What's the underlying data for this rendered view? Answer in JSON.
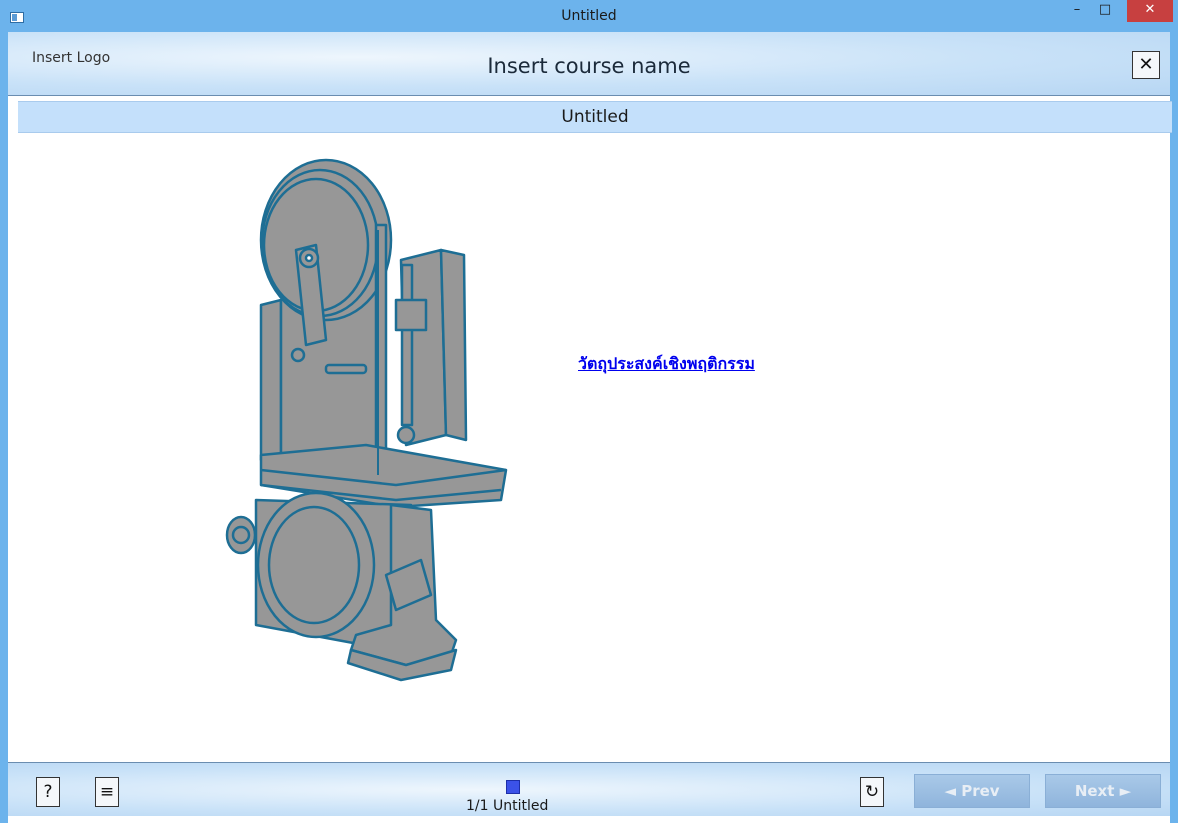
{
  "window": {
    "title": "Untitled",
    "minimize": "–",
    "maximize": "□",
    "close": "✕"
  },
  "header": {
    "logo_text": "Insert Logo",
    "course_name": "Insert course name",
    "close_label": "✕"
  },
  "slide": {
    "title": "Untitled",
    "objective_link": "วัตถุประสงค์เชิงพฤติกรรม"
  },
  "toolbar": {
    "help_label": "?",
    "menu_label": "≡",
    "refresh_label": "↻",
    "page_info": "1/1 Untitled",
    "prev_label": "◄ Prev",
    "next_label": "Next ►"
  },
  "icons": [
    "app-icon",
    "bandsaw-machine-illustration",
    "help-icon",
    "menu-icon",
    "refresh-icon"
  ]
}
